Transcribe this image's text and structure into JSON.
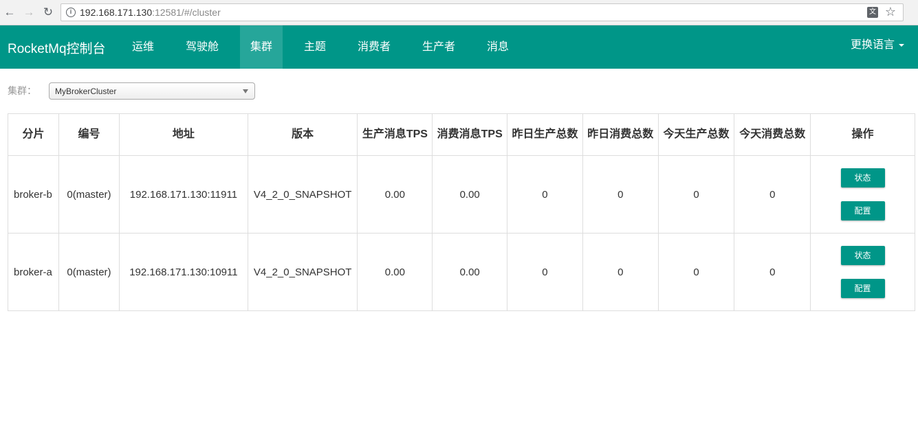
{
  "browser": {
    "url_host": "192.168.171.130",
    "url_rest": ":12581/#/cluster"
  },
  "navbar": {
    "brand": "RocketMq控制台",
    "items": [
      "运维",
      "驾驶舱",
      "集群",
      "主题",
      "消费者",
      "生产者",
      "消息"
    ],
    "active_index": 2,
    "language": "更换语言"
  },
  "cluster": {
    "label": "集群：",
    "selected": "MyBrokerCluster"
  },
  "table": {
    "headers": [
      "分片",
      "编号",
      "地址",
      "版本",
      "生产消息TPS",
      "消费消息TPS",
      "昨日生产总数",
      "昨日消费总数",
      "今天生产总数",
      "今天消费总数",
      "操作"
    ],
    "rows": [
      {
        "shard": "broker-b",
        "id": "0(master)",
        "address": "192.168.171.130:11911",
        "version": "V4_2_0_SNAPSHOT",
        "produce_tps": "0.00",
        "consume_tps": "0.00",
        "yesterday_produce": "0",
        "yesterday_consume": "0",
        "today_produce": "0",
        "today_consume": "0",
        "status_btn": "状态",
        "config_btn": "配置"
      },
      {
        "shard": "broker-a",
        "id": "0(master)",
        "address": "192.168.171.130:10911",
        "version": "V4_2_0_SNAPSHOT",
        "produce_tps": "0.00",
        "consume_tps": "0.00",
        "yesterday_produce": "0",
        "yesterday_consume": "0",
        "today_produce": "0",
        "today_consume": "0",
        "status_btn": "状态",
        "config_btn": "配置"
      }
    ]
  },
  "colors": {
    "primary": "#009688",
    "active_nav": "#26a69a"
  }
}
